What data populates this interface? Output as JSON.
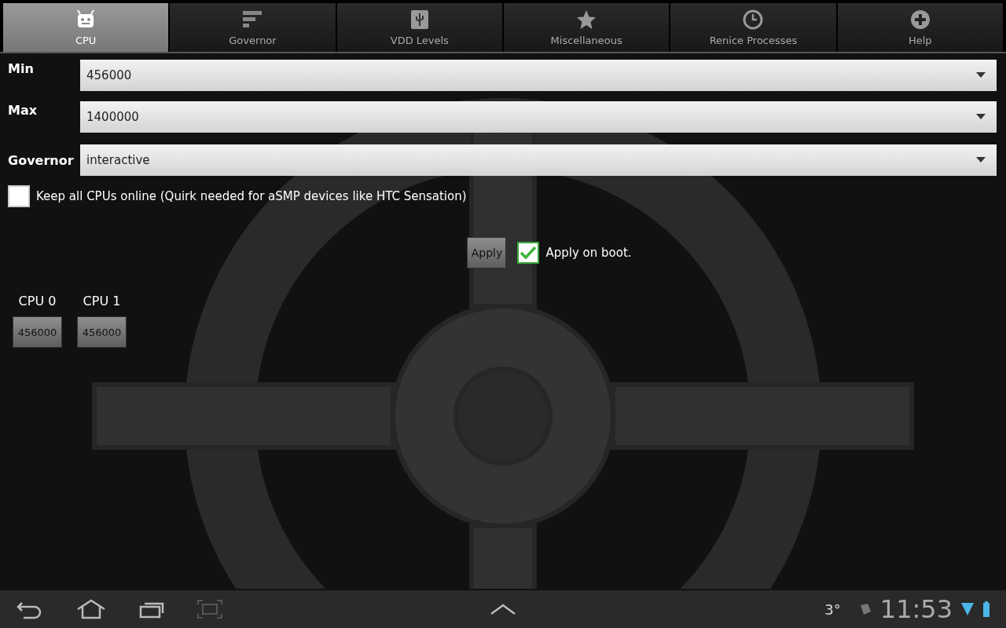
{
  "tabs": [
    {
      "label": "CPU",
      "selected": true
    },
    {
      "label": "Governor",
      "selected": false
    },
    {
      "label": "VDD Levels",
      "selected": false
    },
    {
      "label": "Miscellaneous",
      "selected": false
    },
    {
      "label": "Renice Processes",
      "selected": false
    },
    {
      "label": "Help",
      "selected": false
    }
  ],
  "frequency": [
    {
      "label": "Min",
      "value": "456000"
    },
    {
      "label": "Max",
      "value": "1400000"
    }
  ],
  "governor": {
    "label": "Governor",
    "value": "interactive"
  },
  "keep_online": {
    "label": "Keep all CPUs online (Quirk needed for aSMP devices like HTC Sensation)",
    "checked": false
  },
  "apply": {
    "button": "Apply",
    "on_boot": {
      "label": "Apply on boot.",
      "checked": true
    }
  },
  "cpus": [
    {
      "label": "CPU 0",
      "value": "456000"
    },
    {
      "label": "CPU 1",
      "value": "456000"
    }
  ],
  "status_bar": {
    "temperature": "3°",
    "time": "11:53"
  }
}
